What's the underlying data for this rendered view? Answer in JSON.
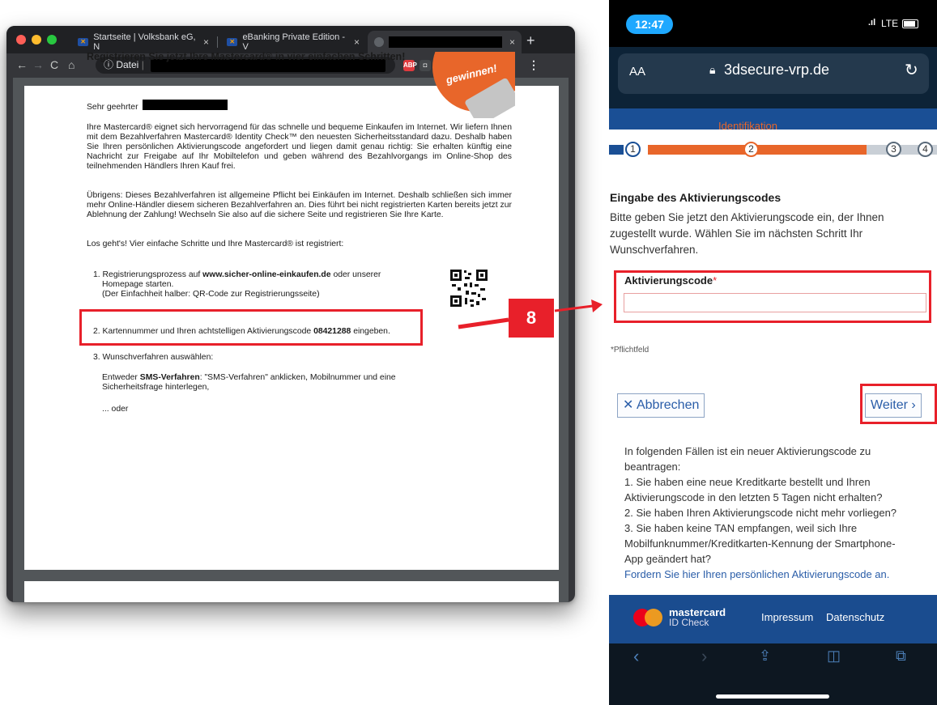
{
  "browser": {
    "tabs": [
      {
        "label": "Startseite | Volksbank eG, N"
      },
      {
        "label": "eBanking Private Edition - V"
      }
    ],
    "tab_close": "×",
    "new_tab": "+",
    "omnibox_prefix": "ⓘ Datei",
    "menu": "⋮"
  },
  "document": {
    "heading": "Registrieren Sie jetzt Ihre Mastercard® in vier einfachen Schritten!",
    "sticker": "gewinnen!",
    "salutation": "Sehr geehrter",
    "para1": "Ihre Mastercard® eignet sich hervorragend für das schnelle und bequeme Einkaufen im Internet. Wir liefern Ihnen mit dem Bezahlverfahren Mastercard® Identity Check™ den neuesten Sicherheitsstandard dazu. Deshalb haben Sie Ihren persönlichen Aktivierungscode angefordert und liegen damit genau richtig: Sie erhalten künftig eine Nachricht zur Freigabe auf Ihr Mobiltelefon und geben während des Bezahlvorgangs im Online-Shop des teilnehmenden Händlers Ihren Kauf frei.",
    "para2": "Übrigens: Dieses Bezahlverfahren ist allgemeine Pflicht bei Einkäufen im Internet. Deshalb schließen sich immer mehr Online-Händler diesem sicheren Bezahlverfahren an. Dies führt bei nicht registrierten Karten bereits jetzt zur Ablehnung der Zahlung! Wechseln Sie also auf die sichere Seite und registrieren Sie Ihre Karte.",
    "para3": "Los geht's! Vier einfache Schritte und Ihre Mastercard® ist registriert:",
    "step1_a": "1. Registrierungsprozess auf",
    "step1_link": "www.sicher-online-einkaufen.de",
    "step1_b": "oder unserer",
    "step1_c": "Homepage starten.",
    "step1_d": "(Der Einfachheit halber: QR-Code zur Registrierungsseite)",
    "step2_a": "2. Kartennummer und Ihren achtstelligen Aktivierungscode",
    "step2_code": "08421288",
    "step2_b": "eingeben.",
    "step3": "3. Wunschverfahren auswählen:",
    "step3_a": "Entweder",
    "step3_sms": "SMS-Verfahren",
    "step3_b": ": \"SMS-Verfahren\" anklicken, Mobilnummer und eine",
    "step3_c": "Sicherheitsfrage hinterlegen,",
    "step3_or": "... oder"
  },
  "annotation": {
    "badge": "8",
    "accent": "#e8202a"
  },
  "phone": {
    "time": "12:47",
    "network": "LTE",
    "text_size": "AA",
    "domain": "3dsecure-vrp.de",
    "step_label": "Identifikation",
    "steps": [
      "1",
      "2",
      "3",
      "4"
    ],
    "section_title": "Eingabe des Aktivierungscodes",
    "instructions": "Bitte geben Sie jetzt den Aktivierungscode ein, der Ihnen zugestellt wurde. Wählen Sie im nächsten Schritt Ihr Wunschverfahren.",
    "field_label": "Aktivierungscode",
    "required_mark": "*",
    "required_note": "*Pflichtfeld",
    "cancel_label": "✕ Abbrechen",
    "next_label": "Weiter ›",
    "info_lines": [
      "In folgenden Fällen ist ein neuer Aktivierungscode zu",
      "beantragen:",
      "1. Sie haben eine neue Kreditkarte bestellt und Ihren",
      "Aktivierungscode in den letzten 5 Tagen nicht erhalten?",
      "2. Sie haben Ihren Aktivierungscode nicht mehr vorliegen?",
      "3. Sie haben keine TAN empfangen, weil sich Ihre",
      "Mobilfunknummer/Kreditkarten-Kennung der Smartphone-",
      "App geändert hat?"
    ],
    "request_link": "Fordern Sie hier Ihren persönlichen Aktivierungscode an.",
    "footer_brand": "mastercard",
    "footer_brand_sub": "ID Check",
    "impressum": "Impressum",
    "datenschutz": "Datenschutz"
  }
}
